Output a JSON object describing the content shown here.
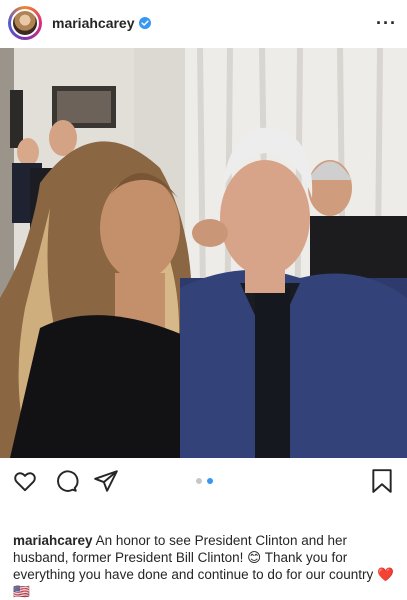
{
  "header": {
    "username": "mariahcarey",
    "verified_icon": "verified-badge-icon",
    "more_icon": "more-options-icon"
  },
  "post": {
    "photo_description_icon": "post-photo",
    "carousel": {
      "count": 2,
      "active_index": 1
    }
  },
  "actions": {
    "like_icon": "heart-icon",
    "comment_icon": "comment-icon",
    "share_icon": "share-icon",
    "save_icon": "bookmark-icon"
  },
  "caption": {
    "username": "mariahcarey",
    "text": "An honor to see President Clinton and her husband, former President Bill Clinton! 😊 Thank you for everything you have done and continue to do for our country ❤️ 🇺🇸"
  },
  "colors": {
    "accent": "#3897f0",
    "text": "#262626"
  }
}
